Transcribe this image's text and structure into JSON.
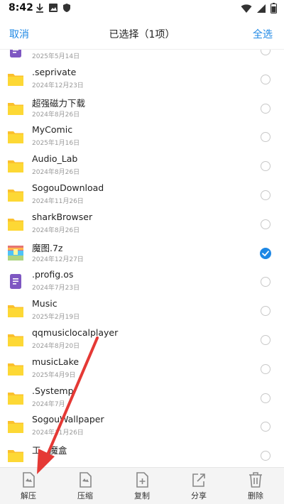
{
  "status": {
    "time": "8:42"
  },
  "header": {
    "cancel_label": "取消",
    "title": "已选择（1项）",
    "select_all_label": "全选"
  },
  "files": [
    {
      "name": "",
      "date": "2025年5月14日",
      "type": "doc",
      "checked": false
    },
    {
      "name": ".seprivate",
      "date": "2024年12月23日",
      "type": "folder",
      "checked": false
    },
    {
      "name": "超强磁力下载",
      "date": "2024年8月26日",
      "type": "folder",
      "checked": false
    },
    {
      "name": "MyComic",
      "date": "2025年1月16日",
      "type": "folder",
      "checked": false
    },
    {
      "name": "Audio_Lab",
      "date": "2024年8月26日",
      "type": "folder",
      "checked": false
    },
    {
      "name": "SogouDownload",
      "date": "2024年11月26日",
      "type": "folder",
      "checked": false
    },
    {
      "name": "sharkBrowser",
      "date": "2024年8月26日",
      "type": "folder",
      "checked": false
    },
    {
      "name": "魔图.7z",
      "date": "2024年12月27日",
      "type": "archive",
      "checked": true
    },
    {
      "name": ".profig.os",
      "date": "2024年7月23日",
      "type": "doc",
      "checked": false
    },
    {
      "name": "Music",
      "date": "2025年2月19日",
      "type": "folder",
      "checked": false
    },
    {
      "name": "qqmusiclocalplayer",
      "date": "2024年8月20日",
      "type": "folder",
      "checked": false
    },
    {
      "name": "musicLake",
      "date": "2025年4月9日",
      "type": "folder",
      "checked": false
    },
    {
      "name": ".Systemp",
      "date": "2024年7月",
      "type": "folder",
      "checked": false
    },
    {
      "name": "SogouWallpaper",
      "date": "2024年11月26日",
      "type": "folder",
      "checked": false
    },
    {
      "name": "工...魔盒",
      "date": "",
      "type": "folder",
      "checked": false
    }
  ],
  "actions": [
    {
      "label": "解压",
      "icon": "extract-icon"
    },
    {
      "label": "压缩",
      "icon": "compress-icon"
    },
    {
      "label": "复制",
      "icon": "copy-icon"
    },
    {
      "label": "分享",
      "icon": "share-icon"
    },
    {
      "label": "删除",
      "icon": "delete-icon"
    }
  ],
  "colors": {
    "accent": "#1e88e5",
    "folder": "#fbc02d",
    "doc": "#7e57c2",
    "annotation_arrow": "#e53935"
  }
}
